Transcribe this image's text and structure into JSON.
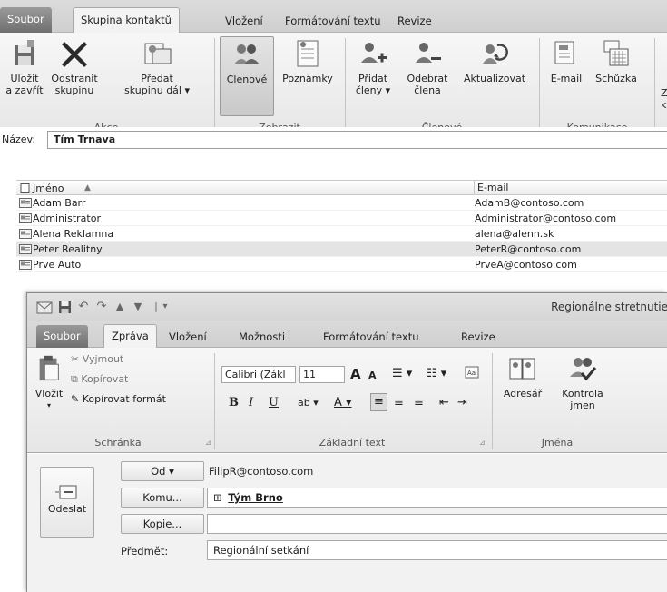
{
  "contact_group": {
    "tabs": [
      "Soubor",
      "Skupina kontaktů",
      "Vložení",
      "Formátování textu",
      "Revize"
    ],
    "ribbon": {
      "save_close": [
        "Uložit",
        "a zavřít"
      ],
      "delete_group": [
        "Odstranit",
        "skupinu"
      ],
      "forward_group": [
        "Předat",
        "skupinu dál ▾"
      ],
      "members": "Členové",
      "notes": "Poznámky",
      "add_members": [
        "Přidat",
        "členy ▾"
      ],
      "remove_member": [
        "Odebrat",
        "člena"
      ],
      "update": "Aktualizovat",
      "email": "E-mail",
      "meeting": "Schůzka",
      "extra_1": "Z",
      "extra_2": "k",
      "groups": [
        "Akce",
        "Zobrazit",
        "Členové",
        "Komunikace"
      ]
    },
    "name_label": "Název:",
    "name_value": "Tím Trnava",
    "columns": {
      "name": "Jméno",
      "sort": "▲",
      "email": "E-mail"
    },
    "members": [
      {
        "name": "Adam Barr",
        "email": "AdamB@contoso.com"
      },
      {
        "name": "Administrator",
        "email": "Administrator@contoso.com"
      },
      {
        "name": "Alena Reklamna",
        "email": "alena@alenn.sk"
      },
      {
        "name": "Peter Realitny",
        "email": "PeterR@contoso.com"
      },
      {
        "name": "Prve Auto",
        "email": "PrveA@contoso.com"
      }
    ]
  },
  "message": {
    "title": "Regionálne stretnutie",
    "qat_sep": "|",
    "qat_more": "▾",
    "tabs": [
      "Soubor",
      "Zpráva",
      "Vložení",
      "Možnosti",
      "Formátování textu",
      "Revize"
    ],
    "clipboard": {
      "paste": "Vložit",
      "paste_arrow": "▾",
      "cut": "Vyjmout",
      "copy": "Kopírovat",
      "format_painter": "Kopírovat formát",
      "group": "Schránka"
    },
    "basic_text": {
      "font": "Calibri (Zákl",
      "size": "11",
      "grow": "A",
      "shrink": "A",
      "bullets": "☰ ▾",
      "numbering": "☷ ▾",
      "bold": "B",
      "italic": "I",
      "underline": "U",
      "highlight": "ab ▾",
      "font_color": "A ▾",
      "align": [
        "≡",
        "≡",
        "≡"
      ],
      "indent": [
        "⇤",
        "⇥"
      ],
      "group": "Základní text"
    },
    "names": {
      "address_book": "Adresář",
      "check_names": [
        "Kontrola",
        "jmen"
      ],
      "group": "Jména"
    },
    "send": "Odeslat",
    "from_button": "Od ▾",
    "from_value": "FilipR@contoso.com",
    "to_button": "Komu...",
    "to_expand": "⊞",
    "to_value": "Tým Brno",
    "cc_button": "Kopie...",
    "cc_value": "",
    "subject_label": "Předmět:",
    "subject_value": "Regionální setkání"
  }
}
